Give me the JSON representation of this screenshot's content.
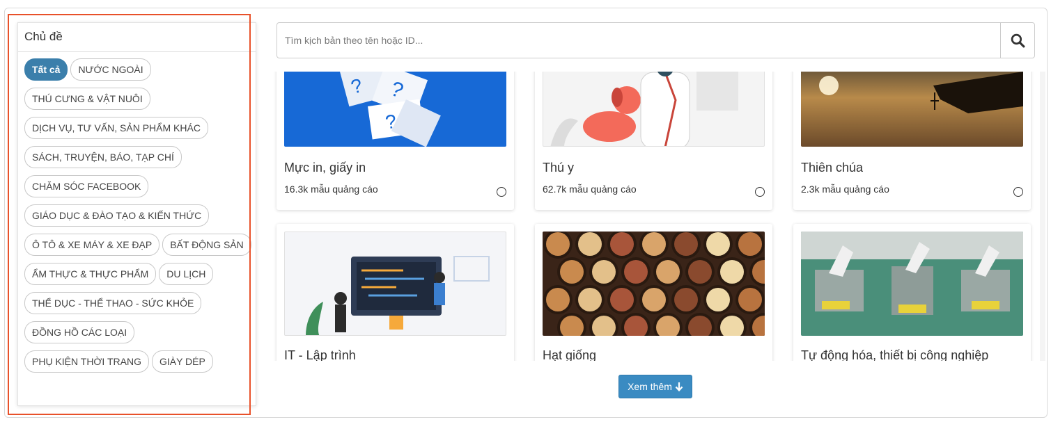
{
  "sidebar": {
    "title": "Chủ đề",
    "tags": [
      {
        "label": "Tất cả",
        "active": true
      },
      {
        "label": "NƯỚC NGOÀI"
      },
      {
        "label": "THÚ CƯNG & VẬT NUÔI"
      },
      {
        "label": "DỊCH VỤ, TƯ VẤN, SẢN PHẨM KHÁC"
      },
      {
        "label": "SÁCH, TRUYỆN, BÁO, TẠP CHÍ"
      },
      {
        "label": "CHĂM SÓC FACEBOOK"
      },
      {
        "label": "GIÁO DỤC & ĐÀO TẠO & KIẾN THỨC"
      },
      {
        "label": "Ô TÔ & XE MÁY & XE ĐẠP"
      },
      {
        "label": "BẤT ĐỘNG SẢN"
      },
      {
        "label": "ẨM THỰC & THỰC PHẨM"
      },
      {
        "label": "DU LỊCH"
      },
      {
        "label": "THỂ DỤC - THỂ THAO - SỨC KHỎE"
      },
      {
        "label": "ĐỒNG HỒ CÁC LOẠI"
      },
      {
        "label": "PHỤ KIỆN THỜI TRANG"
      },
      {
        "label": "GIÀY DÉP"
      }
    ]
  },
  "search": {
    "placeholder": "Tìm kịch bản theo tên hoặc ID...",
    "value": "",
    "icon": "search-icon"
  },
  "cards": [
    {
      "title": "Mực in, giấy in",
      "count": "16.3k mẫu quảng cáo"
    },
    {
      "title": "Thú y",
      "count": "62.7k mẫu quảng cáo"
    },
    {
      "title": "Thiên chúa",
      "count": "2.3k mẫu quảng cáo"
    },
    {
      "title": "IT - Lập trình"
    },
    {
      "title": "Hạt giống"
    },
    {
      "title": "Tự động hóa, thiết bị công nghiệp"
    }
  ],
  "more_button": {
    "label": "Xem thêm",
    "icon": "arrow-down-icon"
  },
  "colors": {
    "accent": "#3a8bc2",
    "active_tag": "#3b7fab",
    "highlight": "#e8512a"
  }
}
